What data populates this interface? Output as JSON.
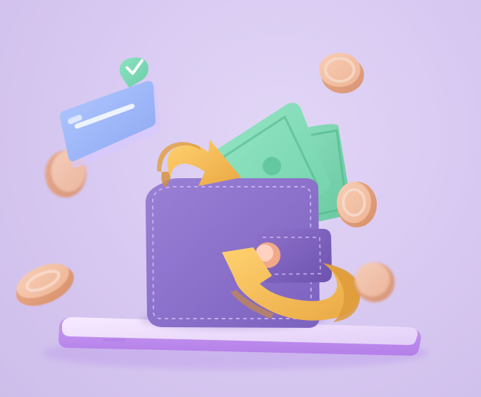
{
  "illustration": {
    "subject": "wallet-money-exchange",
    "icons": [
      "credit-card-icon",
      "check-badge-icon",
      "banknote-icon",
      "wallet-icon",
      "refresh-arrows-icon",
      "coin-icon",
      "smartphone-icon"
    ],
    "colors": {
      "background": "#d9caf2",
      "wallet": "#8a6cc5",
      "cash": "#7ed7b3",
      "arrow": "#f1b84f",
      "coin": "#f1c2a7",
      "card": "#9fb6f5",
      "phone": "#ecdcfb"
    }
  }
}
